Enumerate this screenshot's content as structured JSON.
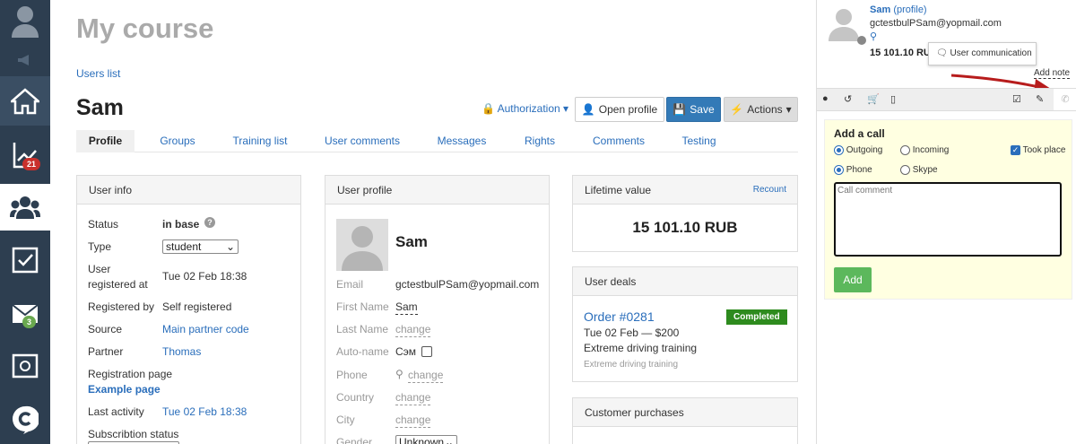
{
  "sidebar": {
    "badges": {
      "stats": "21",
      "mail": "3"
    }
  },
  "page": {
    "title": "My course",
    "breadcrumb": "Users list",
    "user_name": "Sam"
  },
  "toolbar": {
    "authorization": "Authorization",
    "open_profile": "Open profile",
    "save": "Save",
    "actions": "Actions"
  },
  "tabs": [
    "Profile",
    "Groups",
    "Training list",
    "User comments",
    "Messages",
    "Rights",
    "Comments",
    "Testing"
  ],
  "user_info": {
    "header": "User info",
    "status_label": "Status",
    "status_value": "in base",
    "type_label": "Type",
    "type_value": "student",
    "registered_label_1": "User",
    "registered_label_2": "registered at",
    "registered_value": "Tue 02 Feb 18:38",
    "registered_by_label": "Registered by",
    "registered_by_value": "Self registered",
    "source_label": "Source",
    "source_value": "Main partner code",
    "partner_label": "Partner",
    "partner_value": "Thomas",
    "reg_page_label": "Registration page",
    "reg_page_value": "Example page",
    "last_activity_label": "Last activity",
    "last_activity_value": "Tue 02 Feb 18:38",
    "subscription_label": "Subscribtion status"
  },
  "user_profile": {
    "header": "User profile",
    "name": "Sam",
    "email_label": "Email",
    "email_value": "gctestbulPSam@yopmail.com",
    "first_name_label": "First Name",
    "first_name_value": "Sam",
    "last_name_label": "Last Name",
    "change": "change",
    "auto_name_label": "Auto-name",
    "auto_name_value": "Сэм",
    "phone_label": "Phone",
    "country_label": "Country",
    "city_label": "City",
    "gender_label": "Gender",
    "gender_value": "Unknown"
  },
  "lifetime": {
    "header": "Lifetime value",
    "recount": "Recount",
    "value": "15 101.10 RUB"
  },
  "deals": {
    "header": "User deals",
    "order": "Order #0281",
    "status": "Completed",
    "date_price": "Tue 02 Feb — $200",
    "product": "Extreme driving training",
    "product_sub": "Extreme driving training"
  },
  "purchases": {
    "header": "Customer purchases"
  },
  "right_panel": {
    "name": "Sam",
    "profile_link": "(profile)",
    "email": "gctestbulPSam@yopmail.com",
    "balance": "15 101.10 RUB",
    "tooltip": "User communication",
    "add_note": "Add note",
    "add_call": {
      "title": "Add a call",
      "outgoing": "Outgoing",
      "incoming": "Incoming",
      "took_place": "Took place",
      "phone": "Phone",
      "skype": "Skype",
      "placeholder": "Call comment",
      "add_button": "Add"
    }
  },
  "colors": {
    "sidebar": "#2d3e50",
    "primary": "#337ab7",
    "success": "#2e8b1e",
    "add_green": "#5cb85c",
    "note_bg": "#ffffe1",
    "badge_red": "#c9302c",
    "badge_green": "#6aa84f",
    "arrow": "#b71c1c"
  }
}
